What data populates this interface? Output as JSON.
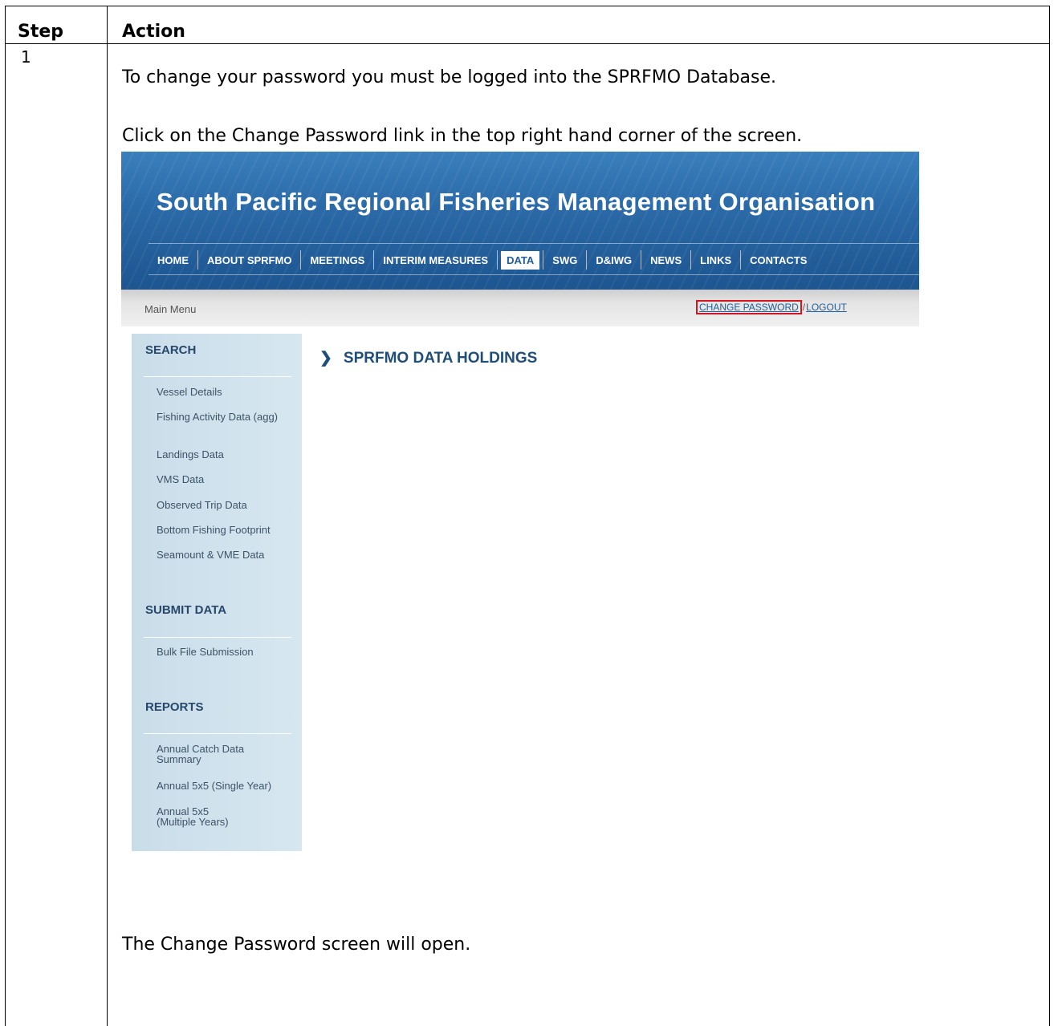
{
  "table": {
    "headers": {
      "step": "Step",
      "action": "Action"
    },
    "row": {
      "step_number": "1",
      "line1": "To change your password you must be logged into the SPRFMO Database.",
      "line2": "Click on the Change Password link in the top right hand corner of the screen.",
      "line3": "The Change Password screen will open."
    }
  },
  "screenshot": {
    "site_title": "South Pacific Regional Fisheries Management Organisation",
    "nav": [
      {
        "label": "HOME",
        "active": false
      },
      {
        "label": "ABOUT SPRFMO",
        "active": false
      },
      {
        "label": "MEETINGS",
        "active": false
      },
      {
        "label": "INTERIM MEASURES",
        "active": false
      },
      {
        "label": "DATA",
        "active": true
      },
      {
        "label": "SWG",
        "active": false
      },
      {
        "label": "D&IWG",
        "active": false
      },
      {
        "label": "NEWS",
        "active": false
      },
      {
        "label": "LINKS",
        "active": false
      },
      {
        "label": "CONTACTS",
        "active": false
      }
    ],
    "menubar": {
      "label": "Main Menu",
      "change_password": "CHANGE PASSWORD",
      "separator": "/",
      "logout": "LOGOUT"
    },
    "content_heading": "SPRFMO DATA HOLDINGS",
    "sidebar": {
      "search": {
        "title": "SEARCH",
        "items": [
          "Vessel Details",
          "Fishing Activity Data (agg)",
          "Landings Data",
          "VMS Data",
          "Observed Trip Data",
          "Bottom Fishing Footprint",
          "Seamount & VME Data"
        ]
      },
      "submit": {
        "title": "SUBMIT DATA",
        "items": [
          "Bulk File Submission"
        ]
      },
      "reports": {
        "title": "REPORTS",
        "items": [
          "Annual Catch Data Summary",
          "Annual 5x5 (Single Year)",
          "Annual 5x5 (Multiple Years)"
        ]
      }
    },
    "colors": {
      "banner": "#2b6aa8",
      "highlight": "#d0161f",
      "link": "#1f5e9c",
      "sidebar": "#d2e4ee"
    }
  }
}
